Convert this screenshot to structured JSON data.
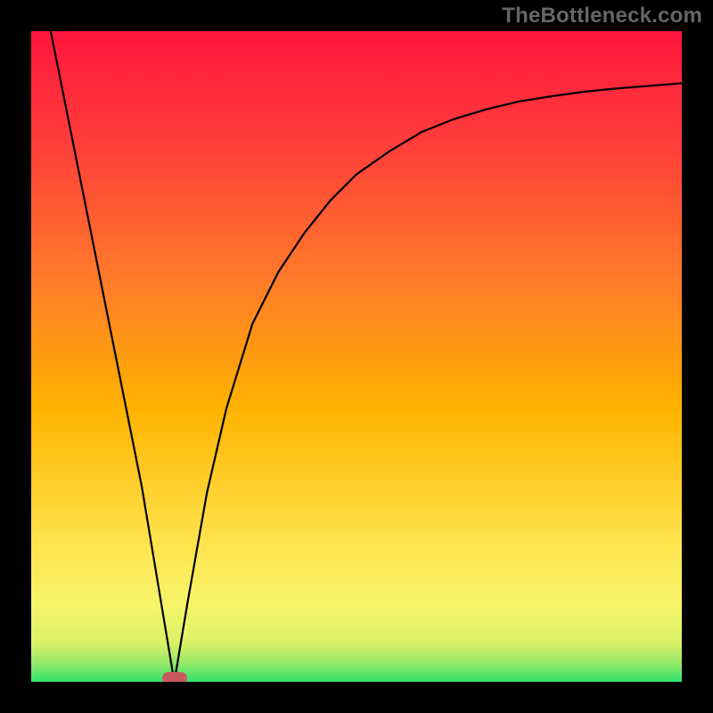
{
  "attribution": "TheBottleneck.com",
  "colors": {
    "bg_black": "#000000",
    "marker": "#cb5a5f",
    "gradient_top": "#ff163c",
    "gradient_mid": "#ffb300",
    "gradient_low": "#f8f46a",
    "gradient_bottom": "#2fe36c"
  },
  "chart_data": {
    "type": "line",
    "title": "",
    "xlabel": "",
    "ylabel": "",
    "xlim": [
      0,
      100
    ],
    "ylim": [
      0,
      100
    ],
    "grid": false,
    "legend": false,
    "notch_x": 22,
    "series": [
      {
        "name": "curve",
        "x": [
          3,
          5,
          8,
          11,
          14,
          17,
          20,
          22,
          24,
          27,
          30,
          34,
          38,
          42,
          46,
          50,
          55,
          60,
          65,
          70,
          75,
          80,
          85,
          90,
          95,
          100
        ],
        "y": [
          100,
          90,
          75,
          60,
          45,
          30,
          12,
          0,
          12,
          29,
          42,
          55,
          63,
          69,
          74,
          78,
          81.5,
          84.5,
          86.5,
          88,
          89.2,
          90,
          90.7,
          91.2,
          91.6,
          92
        ]
      }
    ],
    "marker": {
      "x": 22,
      "y": 0.5
    }
  }
}
